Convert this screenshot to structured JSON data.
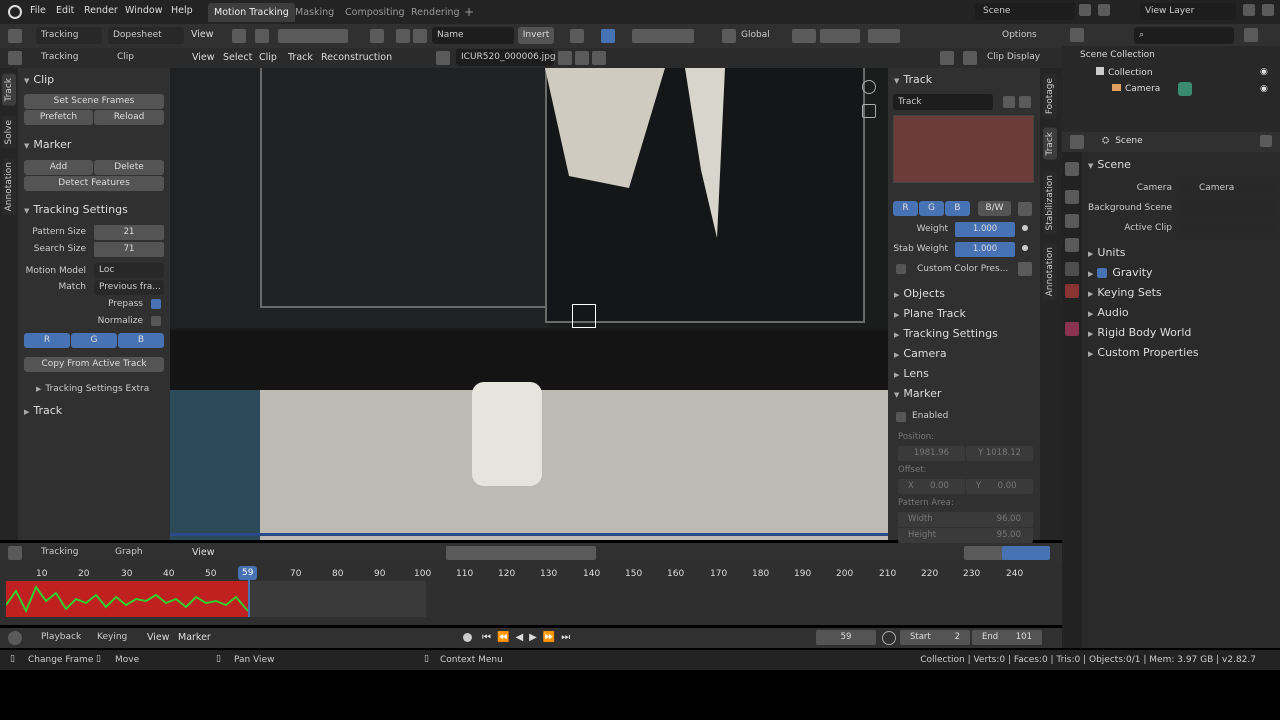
{
  "menus": [
    "File",
    "Edit",
    "Render",
    "Window",
    "Help"
  ],
  "workspaces": [
    "Motion Tracking",
    "Masking",
    "Compositing",
    "Rendering"
  ],
  "add_tab": "+",
  "scene_name": "Scene",
  "view_layer": "View Layer",
  "toolbar": {
    "tracking": "Tracking",
    "dopesheet": "Dopesheet",
    "view": "View",
    "name": "Name",
    "invert": "Invert",
    "global": "Global",
    "options": "Options"
  },
  "clip_header": {
    "tracking": "Tracking",
    "clip": "Clip",
    "menus": [
      "View",
      "Select",
      "Clip",
      "Track",
      "Reconstruction"
    ],
    "filename": "ICUR520_000006.jpg",
    "display": "Clip Display"
  },
  "left_tabs": [
    "Track",
    "Solve",
    "Annotation"
  ],
  "clip_panel": {
    "title": "Clip",
    "set_scene_frames": "Set Scene Frames",
    "prefetch": "Prefetch",
    "reload": "Reload"
  },
  "marker_panel": {
    "title": "Marker",
    "add": "Add",
    "delete": "Delete",
    "detect": "Detect Features"
  },
  "tracking_settings": {
    "title": "Tracking Settings",
    "pattern_size_label": "Pattern Size",
    "pattern_size": "21",
    "search_size_label": "Search Size",
    "search_size": "71",
    "motion_model_label": "Motion Model",
    "motion_model": "Loc",
    "match_label": "Match",
    "match": "Previous fra...",
    "prepass": "Prepass",
    "normalize": "Normalize",
    "r": "R",
    "g": "G",
    "b": "B",
    "copy": "Copy From Active Track",
    "extra": "Tracking Settings Extra"
  },
  "track_panel_left": "Track",
  "right_tabs": [
    "Footage",
    "Track",
    "Stabilization",
    "Annotation"
  ],
  "track_sidebar": {
    "title": "Track",
    "name": "Track",
    "r": "R",
    "g": "G",
    "b": "B",
    "bw": "B/W",
    "weight_label": "Weight",
    "weight": "1.000",
    "stab_label": "Stab Weight",
    "stab": "1.000",
    "custom": "Custom Color Pres...",
    "sections": [
      "Objects",
      "Plane Track",
      "Tracking Settings",
      "Camera",
      "Lens"
    ],
    "marker": "Marker",
    "enabled": "Enabled",
    "position": "Position:",
    "pos_x": "1981.96",
    "pos_y": "Y  1018.12",
    "offset": "Offset:",
    "off_x": "X",
    "off_x_v": "0.00",
    "off_y": "Y",
    "off_y_v": "0.00",
    "pattern_area": "Pattern Area:",
    "width_l": "Width",
    "width_v": "96.00",
    "height_l": "Height",
    "height_v": "95.00",
    "color": "#6e3b3b"
  },
  "outliner": {
    "collection_root": "Scene Collection",
    "collection": "Collection",
    "camera": "Camera"
  },
  "properties": {
    "scene": "Scene",
    "scene_label": "Scene",
    "camera_label": "Camera",
    "camera_value": "Camera",
    "bg_label": "Background Scene",
    "active_clip_label": "Active Clip",
    "sections": [
      "Units",
      "Gravity",
      "Keying Sets",
      "Audio",
      "Rigid Body World",
      "Custom Properties"
    ]
  },
  "graph_header": {
    "tracking": "Tracking",
    "graph": "Graph",
    "view": "View"
  },
  "timeline": {
    "current": "59",
    "ticks": [
      "10",
      "20",
      "30",
      "40",
      "50",
      "70",
      "80",
      "90",
      "100",
      "110",
      "120",
      "130",
      "140",
      "150",
      "160",
      "170",
      "180",
      "190",
      "200",
      "210",
      "220",
      "230",
      "240"
    ]
  },
  "playback": {
    "playback": "Playback",
    "keying": "Keying",
    "view": "View",
    "marker": "Marker",
    "frame": "59",
    "start_l": "Start",
    "start": "2",
    "end_l": "End",
    "end": "101"
  },
  "status": {
    "change_frame": "Change Frame",
    "move": "Move",
    "pan": "Pan View",
    "context": "Context Menu",
    "info": "Collection | Verts:0 | Faces:0 | Tris:0 | Objects:0/1 | Mem: 3.97 GB | v2.82.7"
  }
}
